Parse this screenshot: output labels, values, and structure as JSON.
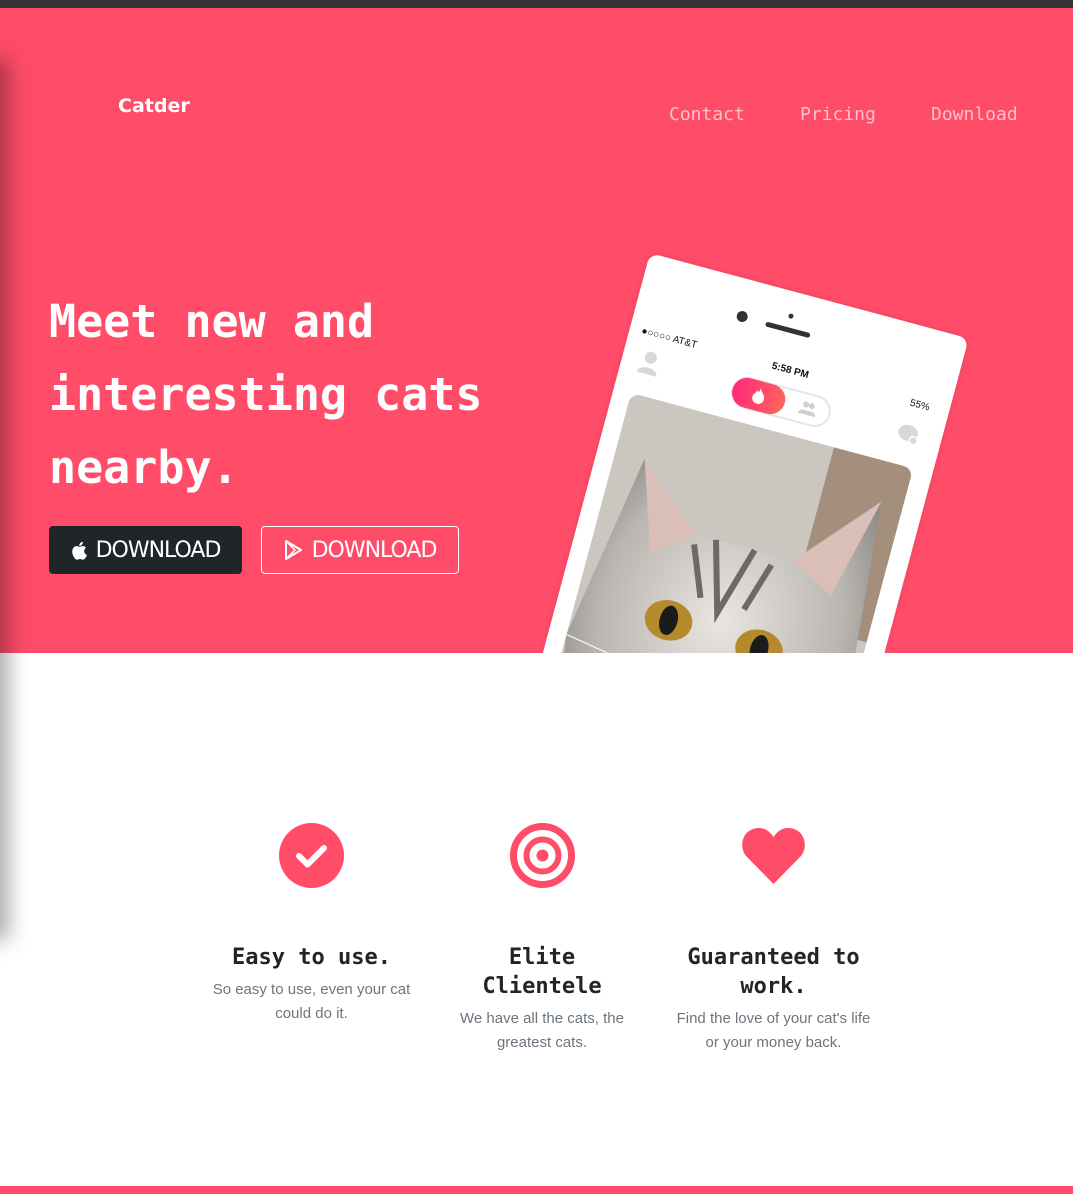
{
  "brand": "Catder",
  "nav": [
    "Contact",
    "Pricing",
    "Download"
  ],
  "hero": {
    "headline_lines": [
      "Meet new and",
      "interesting cats",
      "nearby."
    ],
    "buttons": [
      {
        "label": "DOWNLOAD",
        "icon": "apple-icon",
        "style": "dark"
      },
      {
        "label": "DOWNLOAD",
        "icon": "google-play-icon",
        "style": "outline"
      }
    ],
    "phone": {
      "carrier": "●○○○○ AT&T",
      "time": "5:58 PM",
      "battery": "55%"
    }
  },
  "features": [
    {
      "icon": "check-circle-icon",
      "title": "Easy to use.",
      "text": "So easy to use, even your cat could do it."
    },
    {
      "icon": "target-icon",
      "title": "Elite Clientele",
      "text": "We have all the cats, the greatest cats."
    },
    {
      "icon": "heart-icon",
      "title": "Guaranteed to work.",
      "text": "Find the love of your cat's life or your money back."
    }
  ],
  "colors": {
    "brand": "#ff4c68",
    "dark": "#212529",
    "muted": "#6c757d"
  }
}
